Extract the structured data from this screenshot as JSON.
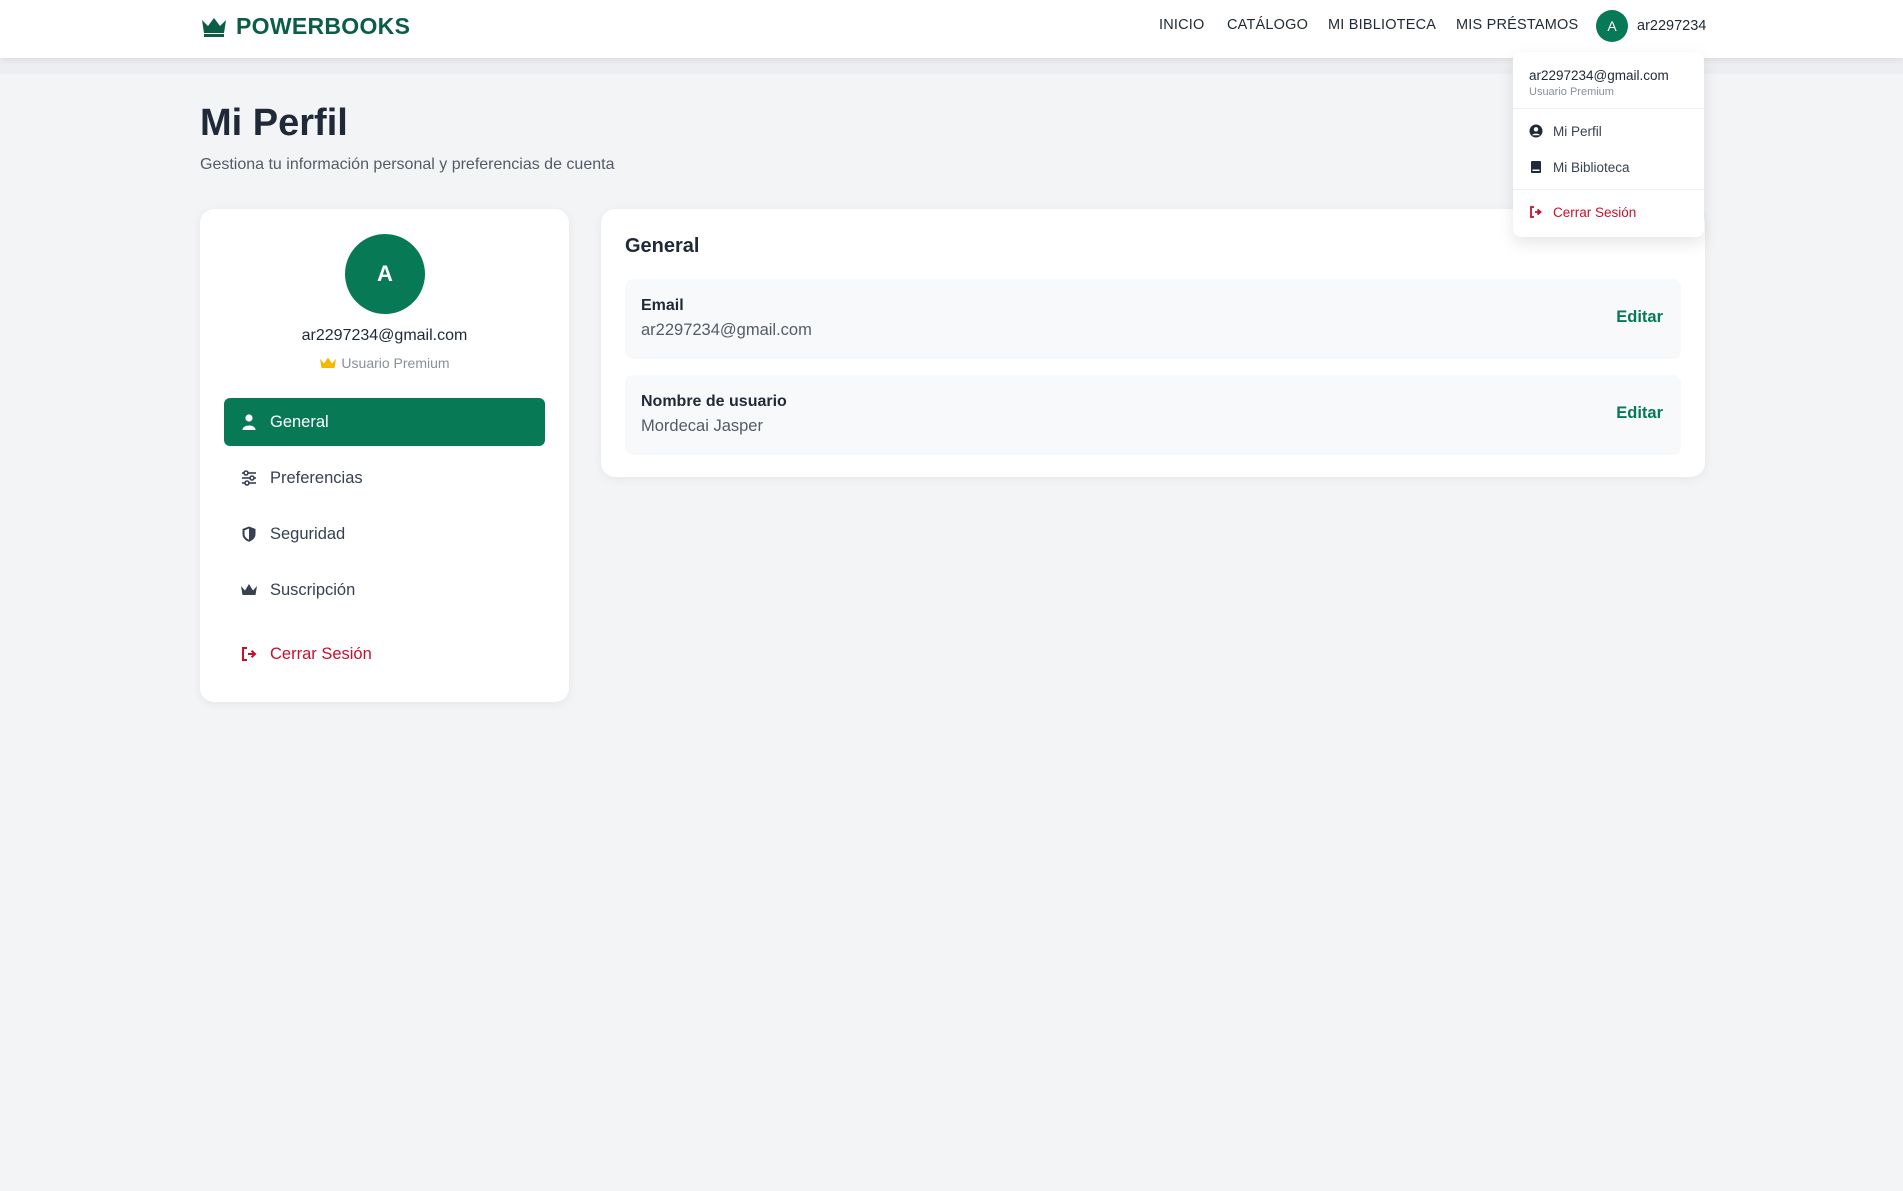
{
  "brand": {
    "name": "POWERBOOKS",
    "icon": "crown-icon",
    "color": "#0b5e44"
  },
  "nav": {
    "links": [
      "INICIO",
      "CATÁLOGO",
      "MI BIBLIOTECA",
      "MIS PRÉSTAMOS"
    ],
    "user": {
      "initial": "A",
      "username": "ar2297234"
    }
  },
  "dropdown": {
    "email": "ar2297234@gmail.com",
    "role": "Usuario Premium",
    "items": [
      {
        "label": "Mi Perfil",
        "icon": "user-circle-icon"
      },
      {
        "label": "Mi Biblioteca",
        "icon": "book-icon"
      }
    ],
    "logout": {
      "label": "Cerrar Sesión",
      "icon": "logout-icon"
    }
  },
  "page": {
    "title": "Mi Perfil",
    "subtitle": "Gestiona tu información personal y preferencias de cuenta"
  },
  "sidebar": {
    "initial": "A",
    "email": "ar2297234@gmail.com",
    "role": "Usuario Premium",
    "items": [
      {
        "label": "General",
        "icon": "user-icon",
        "active": true
      },
      {
        "label": "Preferencias",
        "icon": "sliders-icon",
        "active": false
      },
      {
        "label": "Seguridad",
        "icon": "shield-icon",
        "active": false
      },
      {
        "label": "Suscripción",
        "icon": "crown-icon",
        "active": false
      }
    ],
    "logout": {
      "label": "Cerrar Sesión",
      "icon": "logout-icon"
    }
  },
  "main": {
    "title": "General",
    "fields": [
      {
        "label": "Email",
        "value": "ar2297234@gmail.com",
        "action": "Editar"
      },
      {
        "label": "Nombre de usuario",
        "value": "Mordecai Jasper",
        "action": "Editar"
      }
    ]
  },
  "colors": {
    "accent": "#077a55",
    "danger": "#c8102e",
    "premium_gold": "#f5b800",
    "background": "#f3f4f6"
  }
}
